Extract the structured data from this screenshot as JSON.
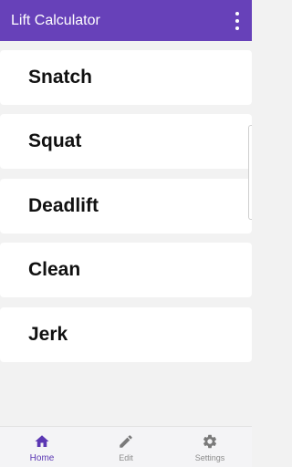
{
  "app_bar": {
    "title": "Lift Calculator",
    "menu_icon": "more-vert-icon",
    "color": "#6741b9"
  },
  "lifts": [
    {
      "label": "Snatch"
    },
    {
      "label": "Squat"
    },
    {
      "label": "Deadlift"
    },
    {
      "label": "Clean"
    },
    {
      "label": "Jerk"
    }
  ],
  "bottom_nav": {
    "active_color": "#5b37b3",
    "items": [
      {
        "label": "Home",
        "icon": "home-icon",
        "active": true
      },
      {
        "label": "Edit",
        "icon": "pencil-icon",
        "active": false
      },
      {
        "label": "Settings",
        "icon": "gear-icon",
        "active": false
      }
    ]
  }
}
